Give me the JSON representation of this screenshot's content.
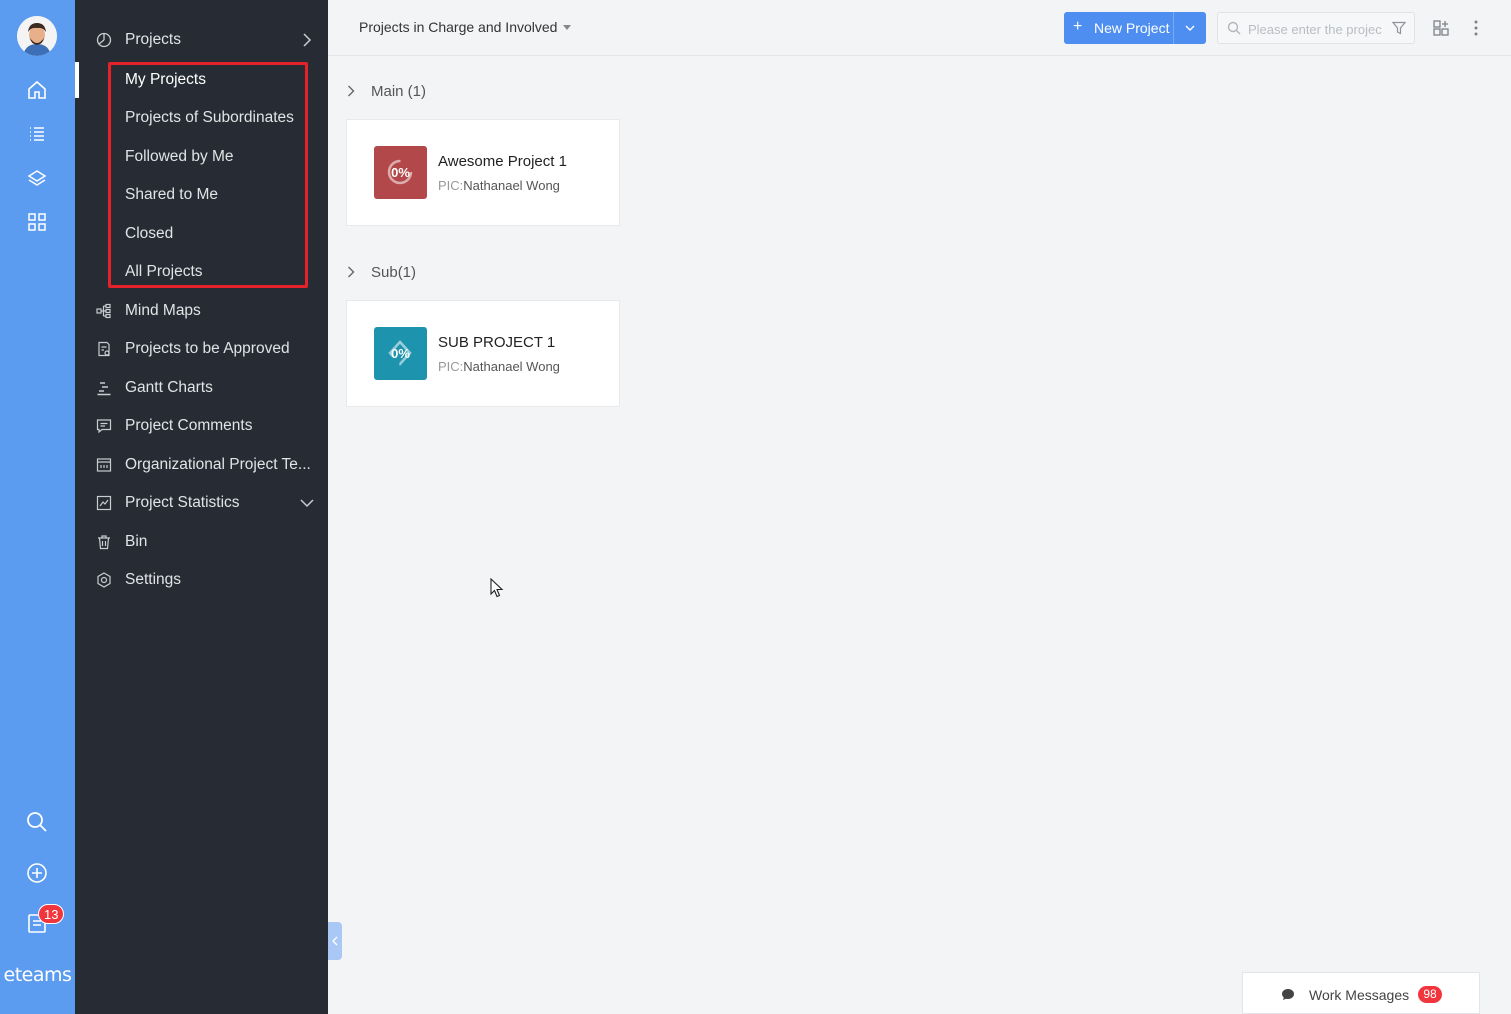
{
  "rail": {
    "brand": "eteams",
    "notification_count": "13"
  },
  "nav": {
    "section_title": "Projects",
    "sub_items": [
      {
        "label": "My Projects"
      },
      {
        "label": "Projects of Subordinates"
      },
      {
        "label": "Followed by Me"
      },
      {
        "label": "Shared to Me"
      },
      {
        "label": "Closed"
      },
      {
        "label": "All Projects"
      }
    ],
    "items": [
      {
        "label": "Mind Maps",
        "icon": "mind-map-icon"
      },
      {
        "label": "Projects to be Approved",
        "icon": "approval-icon"
      },
      {
        "label": "Gantt Charts",
        "icon": "gantt-icon"
      },
      {
        "label": "Project Comments",
        "icon": "comment-icon"
      },
      {
        "label": "Organizational Project Te...",
        "icon": "template-icon"
      },
      {
        "label": "Project Statistics",
        "icon": "statistics-icon"
      },
      {
        "label": "Bin",
        "icon": "bin-icon"
      },
      {
        "label": "Settings",
        "icon": "settings-icon"
      }
    ]
  },
  "topbar": {
    "scope_label": "Projects in Charge and Involved",
    "new_project_label": "New Project",
    "search_placeholder": "Please enter the project"
  },
  "groups": [
    {
      "title": "Main (1)",
      "card": {
        "name": "Awesome Project 1",
        "pic_prefix": "PIC:",
        "pic_name": "Nathanael Wong",
        "progress": "0%",
        "color": "#b3484a"
      }
    },
    {
      "title": "Sub(1)",
      "card": {
        "name": "SUB PROJECT 1",
        "pic_prefix": "PIC:",
        "pic_name": "Nathanael Wong",
        "progress": "0%",
        "color": "#1e93ad"
      }
    }
  ],
  "work_messages": {
    "label": "Work Messages",
    "count": "98"
  },
  "colors": {
    "rail": "#5b9cf0",
    "nav_bg": "#272c34",
    "accent": "#4d8ef0",
    "highlight": "#e52229"
  }
}
